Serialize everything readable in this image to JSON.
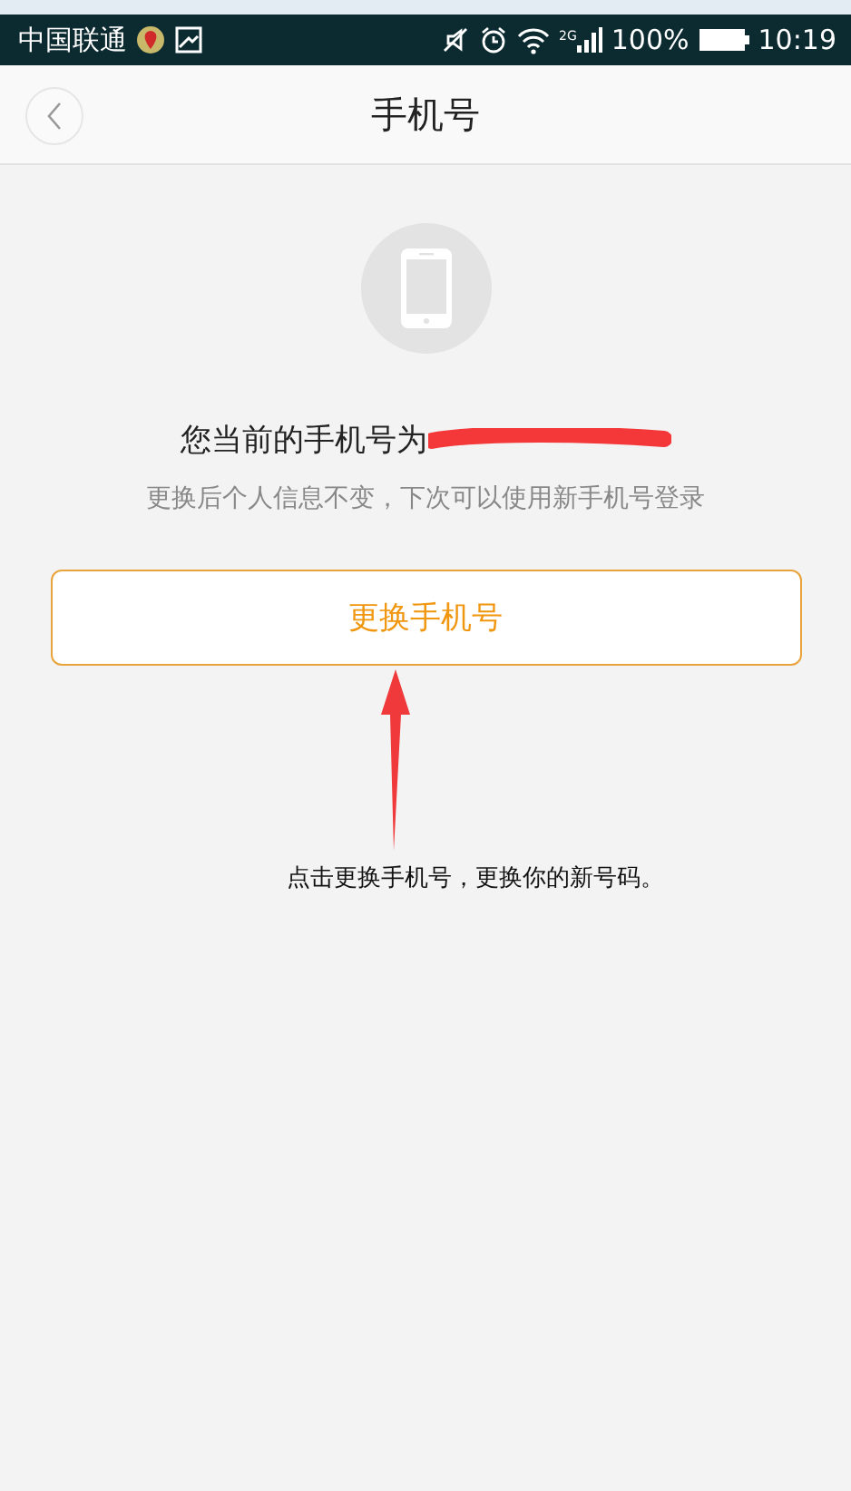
{
  "status_bar": {
    "carrier": "中国联通",
    "network": "2G",
    "battery": "100%",
    "time": "10:19"
  },
  "header": {
    "title": "手机号"
  },
  "current_number": {
    "label": "您当前的手机号为"
  },
  "hint": "更换后个人信息不变，下次可以使用新手机号登录",
  "change_button": "更换手机号",
  "annotation": "点击更换手机号，更换你的新号码。"
}
